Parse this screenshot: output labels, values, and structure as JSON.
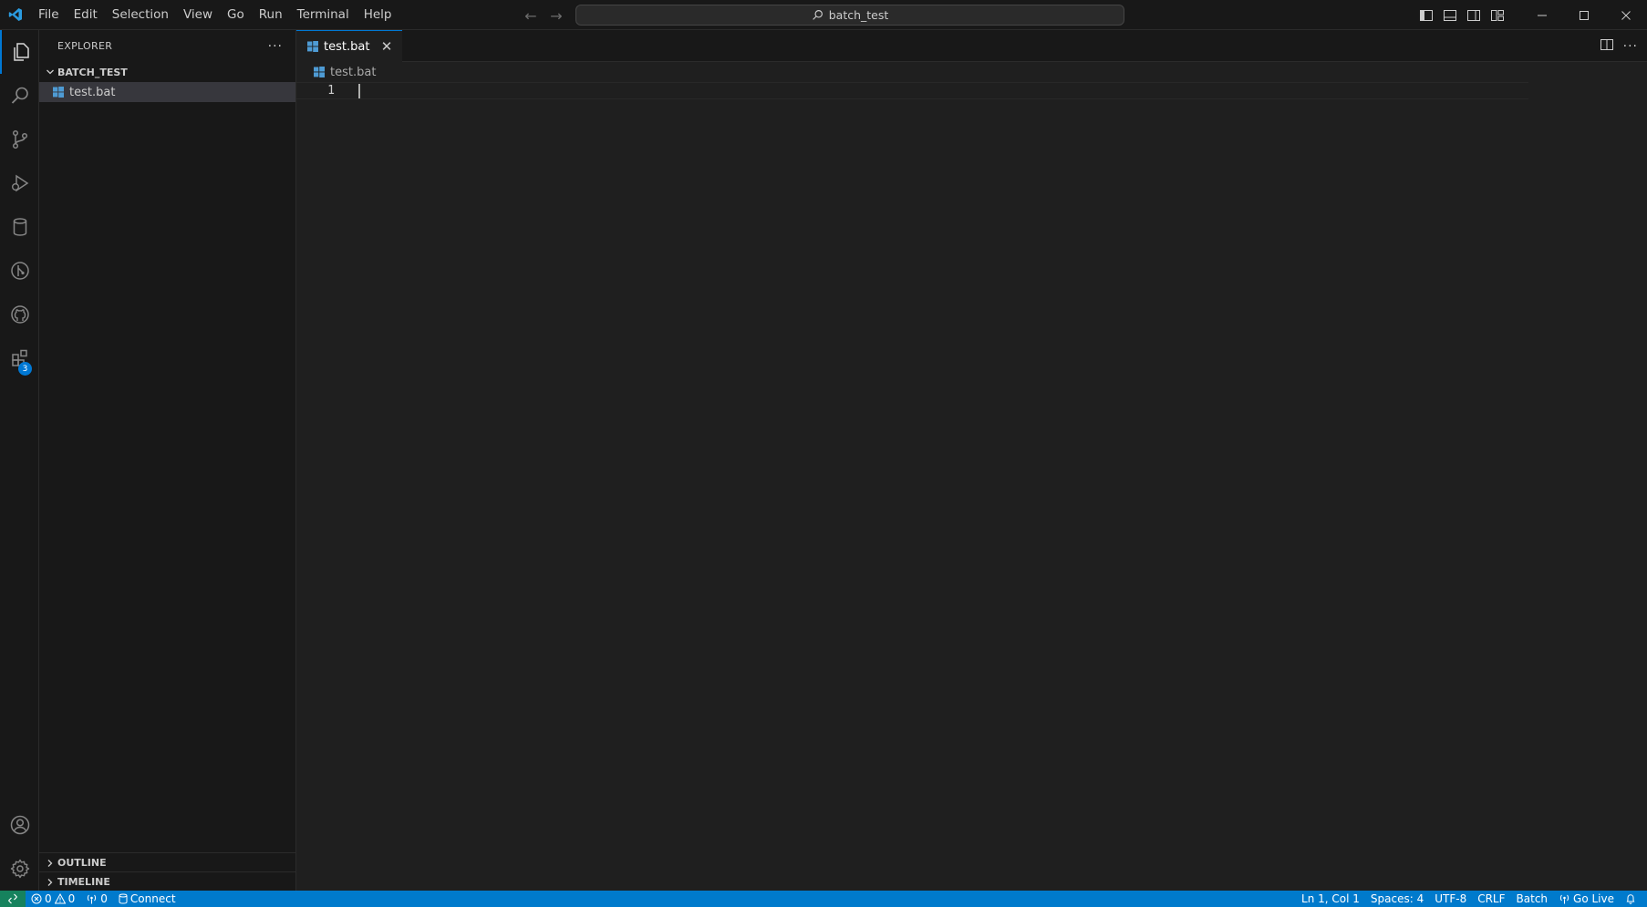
{
  "titlebar": {
    "menu": [
      "File",
      "Edit",
      "Selection",
      "View",
      "Go",
      "Run",
      "Terminal",
      "Help"
    ],
    "search": "batch_test"
  },
  "activity_bar": {
    "items": [
      "explorer-icon",
      "search-icon",
      "source-control-icon",
      "run-debug-icon",
      "database-icon",
      "git-graph-icon",
      "github-icon",
      "extensions-icon"
    ],
    "extensions_badge": "3",
    "bottom": [
      "account-icon",
      "gear-icon"
    ]
  },
  "sidebar": {
    "title": "EXPLORER",
    "more": "···",
    "folder": "BATCH_TEST",
    "files": [
      "test.bat"
    ],
    "outline": "OUTLINE",
    "timeline": "TIMELINE"
  },
  "editor": {
    "tab_label": "test.bat",
    "breadcrumb": "test.bat",
    "line_number": "1",
    "more": "···"
  },
  "statusbar": {
    "errors": "0",
    "warnings": "0",
    "ports": "0",
    "connect": "Connect",
    "position": "Ln 1, Col 1",
    "spaces": "Spaces: 4",
    "encoding": "UTF-8",
    "eol": "CRLF",
    "language": "Batch",
    "golive": "Go Live"
  },
  "colors": {
    "accent": "#0078d4",
    "statusbar": "#007acc",
    "remote": "#16825d",
    "bat_icon": "#4e9bd4"
  }
}
